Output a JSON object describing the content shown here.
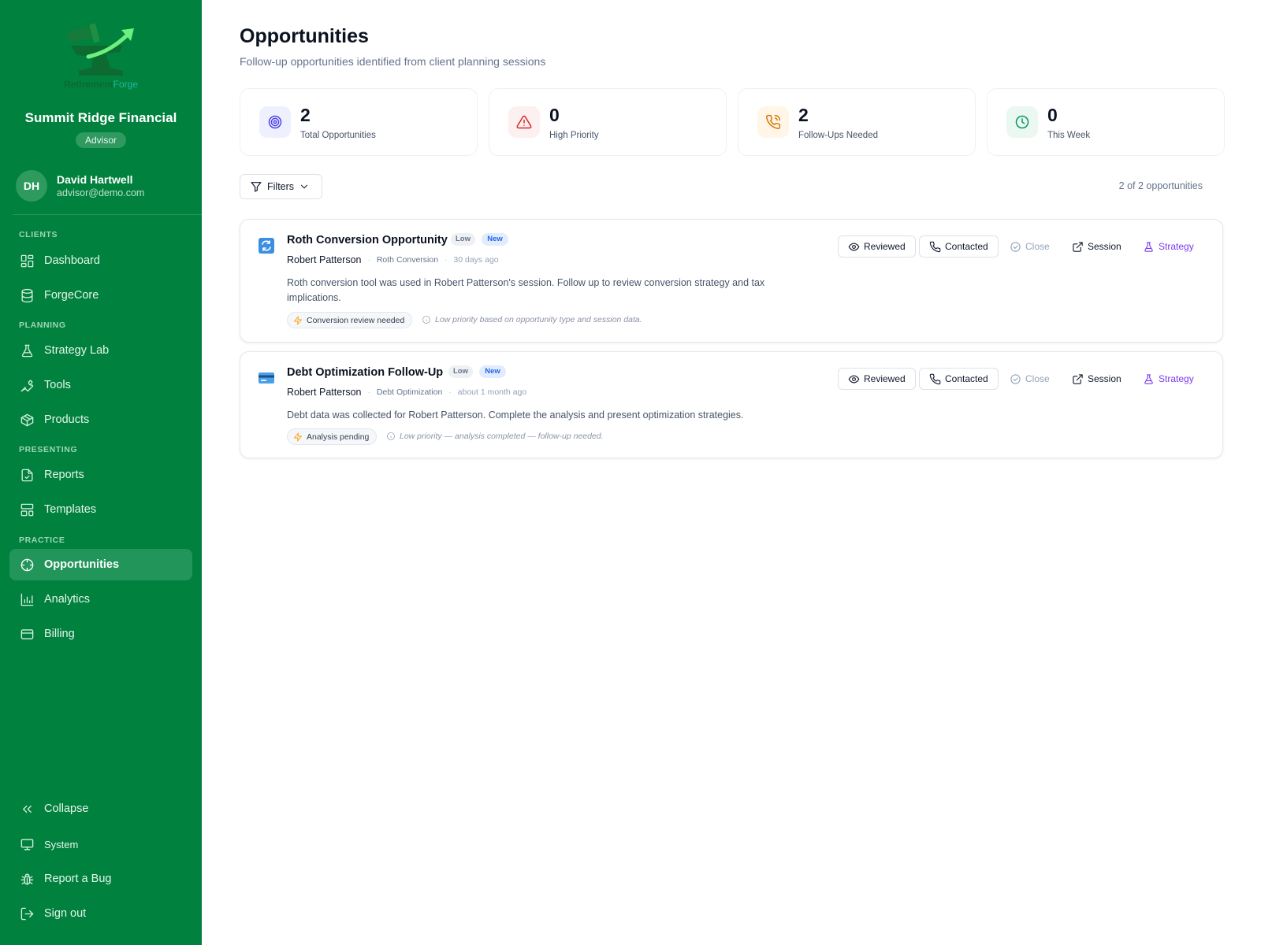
{
  "brand": {
    "logo_word1": "Retirement",
    "logo_word2": "Forge"
  },
  "sidebar": {
    "org_name": "Summit Ridge Financial",
    "role": "Advisor",
    "user": {
      "initials": "DH",
      "name": "David Hartwell",
      "email": "advisor@demo.com"
    },
    "sections": {
      "clients": "CLIENTS",
      "planning": "PLANNING",
      "presenting": "PRESENTING",
      "practice": "PRACTICE"
    },
    "items": [
      {
        "label": "Dashboard",
        "icon": "grid-icon"
      },
      {
        "label": "ForgeCore",
        "icon": "database-icon"
      },
      {
        "label": "Strategy Lab",
        "icon": "flask-icon"
      },
      {
        "label": "Tools",
        "icon": "wrench-icon"
      },
      {
        "label": "Products",
        "icon": "box-icon"
      },
      {
        "label": "Reports",
        "icon": "file-check-icon"
      },
      {
        "label": "Templates",
        "icon": "layout-icon"
      },
      {
        "label": "Opportunities",
        "icon": "crosshair-icon",
        "active": true
      },
      {
        "label": "Analytics",
        "icon": "bar-chart-icon"
      },
      {
        "label": "Billing",
        "icon": "credit-card-icon"
      }
    ],
    "footer": {
      "collapse": "Collapse",
      "system": "System",
      "report_bug": "Report a Bug",
      "sign_out": "Sign out"
    }
  },
  "page": {
    "title": "Opportunities",
    "subtitle": "Follow-up opportunities identified from client planning sessions"
  },
  "stats": [
    {
      "value": "2",
      "label": "Total Opportunities",
      "icon": "target-icon",
      "color": "#4f46e5"
    },
    {
      "value": "0",
      "label": "High Priority",
      "icon": "alert-triangle-icon",
      "color": "#dc2626"
    },
    {
      "value": "2",
      "label": "Follow-Ups Needed",
      "icon": "phone-call-icon",
      "color": "#d97706"
    },
    {
      "value": "0",
      "label": "This Week",
      "icon": "clock-icon",
      "color": "#059669"
    }
  ],
  "toolbar": {
    "filters_label": "Filters",
    "count_text": "2 of 2 opportunities"
  },
  "actions": {
    "reviewed": "Reviewed",
    "contacted": "Contacted",
    "close": "Close",
    "session": "Session",
    "strategy": "Strategy"
  },
  "opportunities": [
    {
      "title": "Roth Conversion Opportunity",
      "priority": "Low",
      "status": "New",
      "client": "Robert Patterson",
      "type": "Roth Conversion",
      "age": "30 days ago",
      "description": "Roth conversion tool was used in Robert Patterson's session. Follow up to review conversion strategy and tax implications.",
      "tag": "Conversion review needed",
      "note": "Low priority based on opportunity type and session data.",
      "icon": "refresh-icon"
    },
    {
      "title": "Debt Optimization Follow-Up",
      "priority": "Low",
      "status": "New",
      "client": "Robert Patterson",
      "type": "Debt Optimization",
      "age": "about 1 month ago",
      "description": "Debt data was collected for Robert Patterson. Complete the analysis and present optimization strategies.",
      "tag": "Analysis pending",
      "note": "Low priority — analysis completed — follow-up needed.",
      "icon": "credit-card-icon"
    }
  ]
}
